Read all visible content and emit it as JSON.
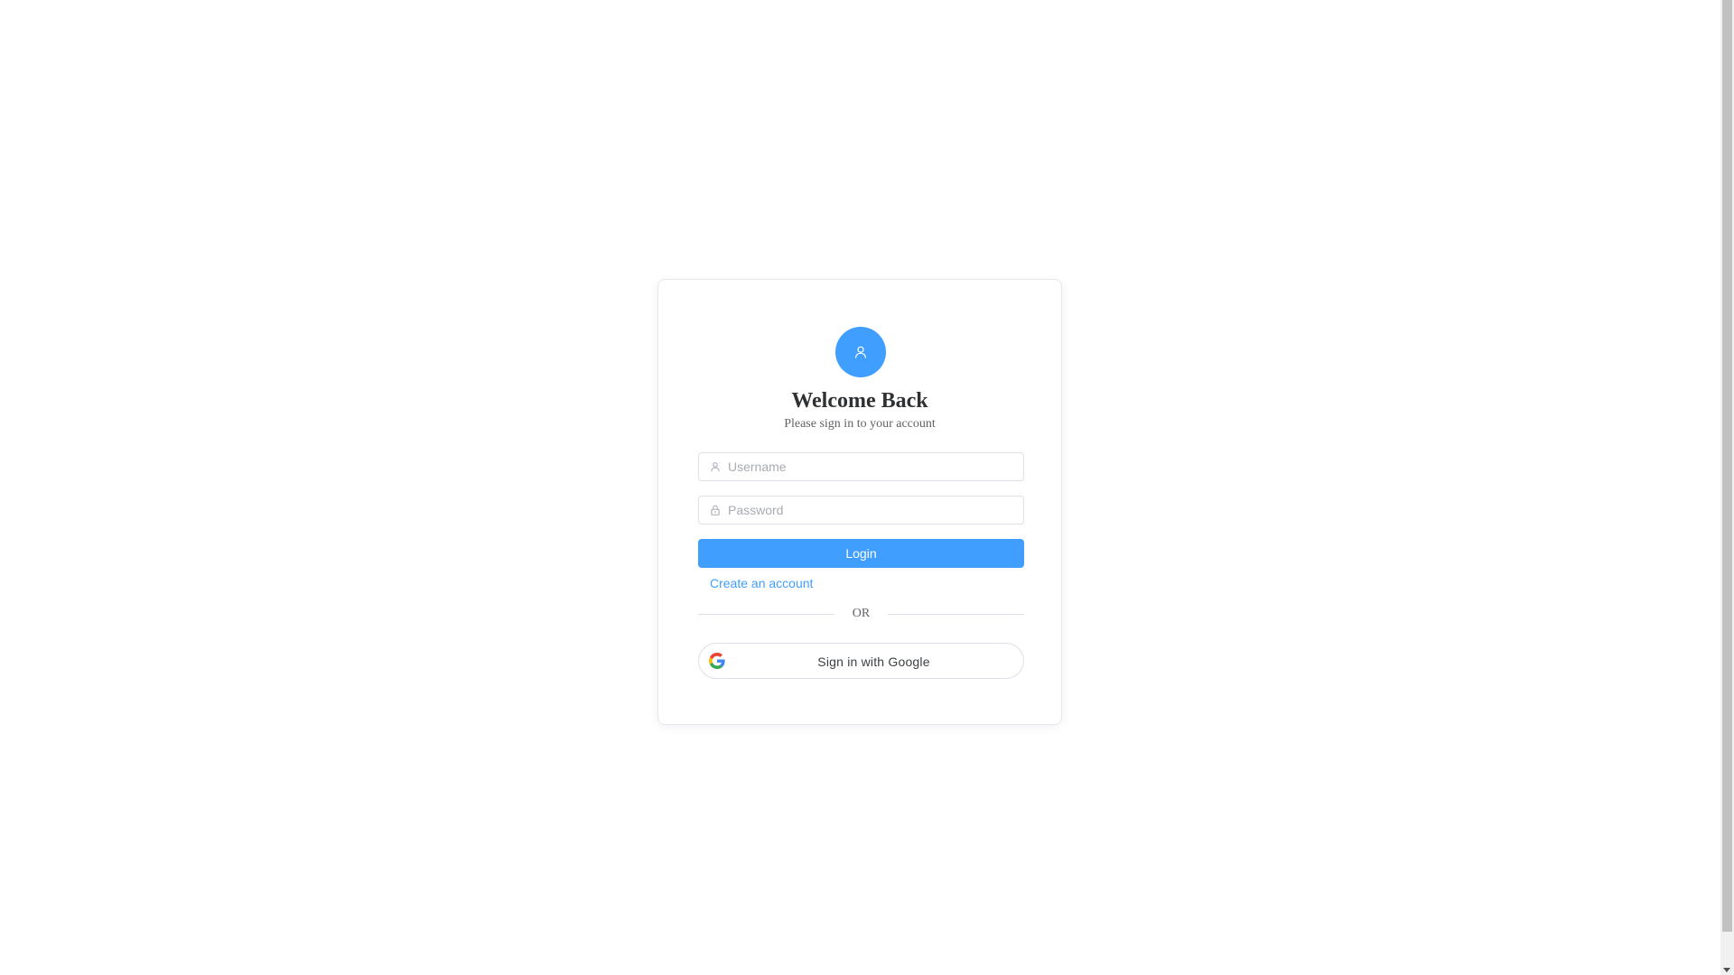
{
  "login_card": {
    "title": "Welcome Back",
    "subtitle": "Please sign in to your account",
    "avatar_icon": "user-icon",
    "username": {
      "placeholder": "Username",
      "value": "",
      "icon": "user-icon"
    },
    "password": {
      "placeholder": "Password",
      "value": "",
      "icon": "lock-icon"
    },
    "login_label": "Login",
    "create_account_label": "Create an account",
    "divider_label": "OR",
    "google_label": "Sign in with Google",
    "google_icon": "google-icon"
  },
  "colors": {
    "primary": "#409eff",
    "title": "#303133",
    "text": "#606266",
    "placeholder": "#a8abb2",
    "border": "#dcdfe6"
  }
}
